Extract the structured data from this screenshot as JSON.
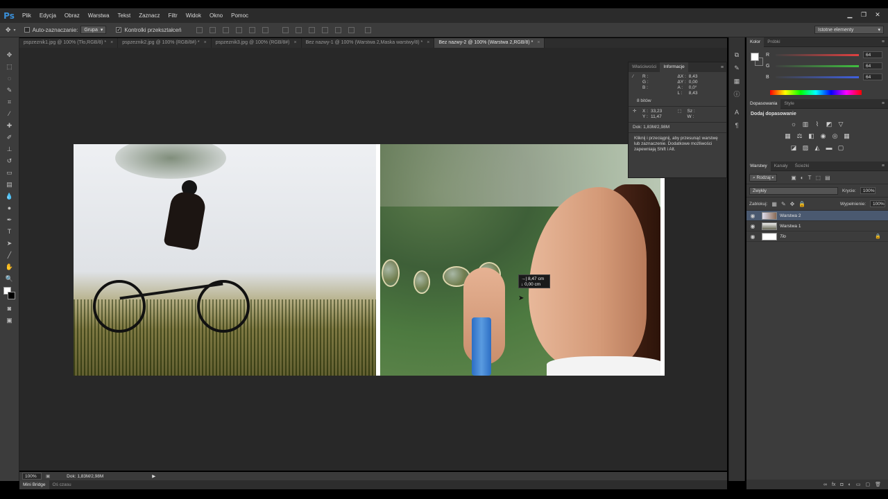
{
  "app": {
    "logo": "Ps"
  },
  "menu": [
    "Plik",
    "Edycja",
    "Obraz",
    "Warstwa",
    "Tekst",
    "Zaznacz",
    "Filtr",
    "Widok",
    "Okno",
    "Pomoc"
  ],
  "options": {
    "auto_select_label": "Auto-zaznaczanie:",
    "group_value": "Grupa",
    "transform_controls_label": "Kontrolki przekształceń",
    "workspace_value": "Istotne elementy"
  },
  "tabs": [
    {
      "label": "pspzeznik1.jpg @ 100% (Tło,RGB/8) *",
      "active": false
    },
    {
      "label": "pspzeznik2.jpg @ 100% (RGB/8#) *",
      "active": false
    },
    {
      "label": "pspzeznik3.jpg @ 100% (RGB/8#)",
      "active": false
    },
    {
      "label": "Bez nazwy-1 @ 100% (Warstwa 2,Maska warstwy/8) *",
      "active": false
    },
    {
      "label": "Bez nazwy-2 @ 100% (Warstwa 2,RGB/8) *",
      "active": true
    }
  ],
  "measure_tip": {
    "dx": "8,47 cm",
    "dy": "0,00 cm"
  },
  "info_panel": {
    "tab_properties": "Właściwości",
    "tab_info": "Informacje",
    "rgb_labels": [
      "R :",
      "G :",
      "B :"
    ],
    "delta_labels": [
      "ΔX :",
      "ΔY :",
      "A :",
      "L :"
    ],
    "delta_values": [
      "8,43",
      "0,00",
      "0,0°",
      "8,43"
    ],
    "bits": "8 bitów",
    "x_label": "X :",
    "x_value": "33,23",
    "y_label": "Y :",
    "y_value": "11,47",
    "w_label": "Sz :",
    "h_label": "W :",
    "doc": "Dok: 1,83M/2,98M",
    "help": "Kliknij i przeciągnij, aby przesunąć warstwę lub zaznaczenie. Dodatkowe możliwości zapewniają Shift i Alt."
  },
  "color_panel": {
    "tab_color": "Kolor",
    "tab_swatches": "Próbki",
    "sliders": [
      {
        "label": "R",
        "value": "64",
        "color": "#e04040"
      },
      {
        "label": "G",
        "value": "64",
        "color": "#40c040"
      },
      {
        "label": "B",
        "value": "64",
        "color": "#4060e0"
      }
    ]
  },
  "adjustments_panel": {
    "tab_adjustments": "Dopasowania",
    "tab_styles": "Style",
    "title": "Dodaj dopasowanie"
  },
  "layers_panel": {
    "tab_layers": "Warstwy",
    "tab_channels": "Kanały",
    "tab_paths": "Ścieżki",
    "kind_value": "Rodzaj",
    "blend_value": "Zwykły",
    "opacity_label": "Krycie:",
    "opacity_value": "100%",
    "lock_label": "Zablokuj:",
    "fill_label": "Wypełnienie:",
    "fill_value": "100%",
    "layers": [
      {
        "name": "Warstwa 2",
        "selected": true
      },
      {
        "name": "Warstwa 1",
        "selected": false
      },
      {
        "name": "Tło",
        "selected": false
      }
    ]
  },
  "status": {
    "zoom": "100%",
    "doc": "Dok: 1,83M/2,98M"
  },
  "bottom_tabs": [
    "Mini Bridge",
    "Oś czasu"
  ]
}
